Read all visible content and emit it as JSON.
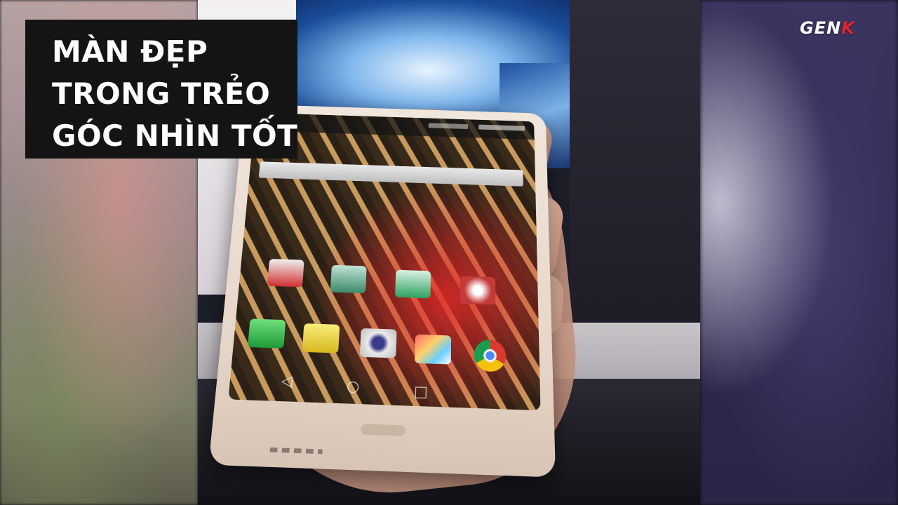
{
  "caption": {
    "lines": [
      "MÀN ĐẸP",
      "TRONG TRẺO",
      "GÓC NHÌN TỐT"
    ]
  },
  "brand": {
    "prefix": "GEN",
    "suffix": "K",
    "accent_color": "#e3232c"
  },
  "phone": {
    "nav_icons": [
      "back-icon",
      "home-icon",
      "recent-apps-icon"
    ],
    "app_icons": [
      "contacts-icon",
      "gallery-icon",
      "photos-icon",
      "settings-icon",
      "phone-icon",
      "messages-icon",
      "camera-icon",
      "gallery-alt-icon",
      "chrome-icon"
    ]
  }
}
